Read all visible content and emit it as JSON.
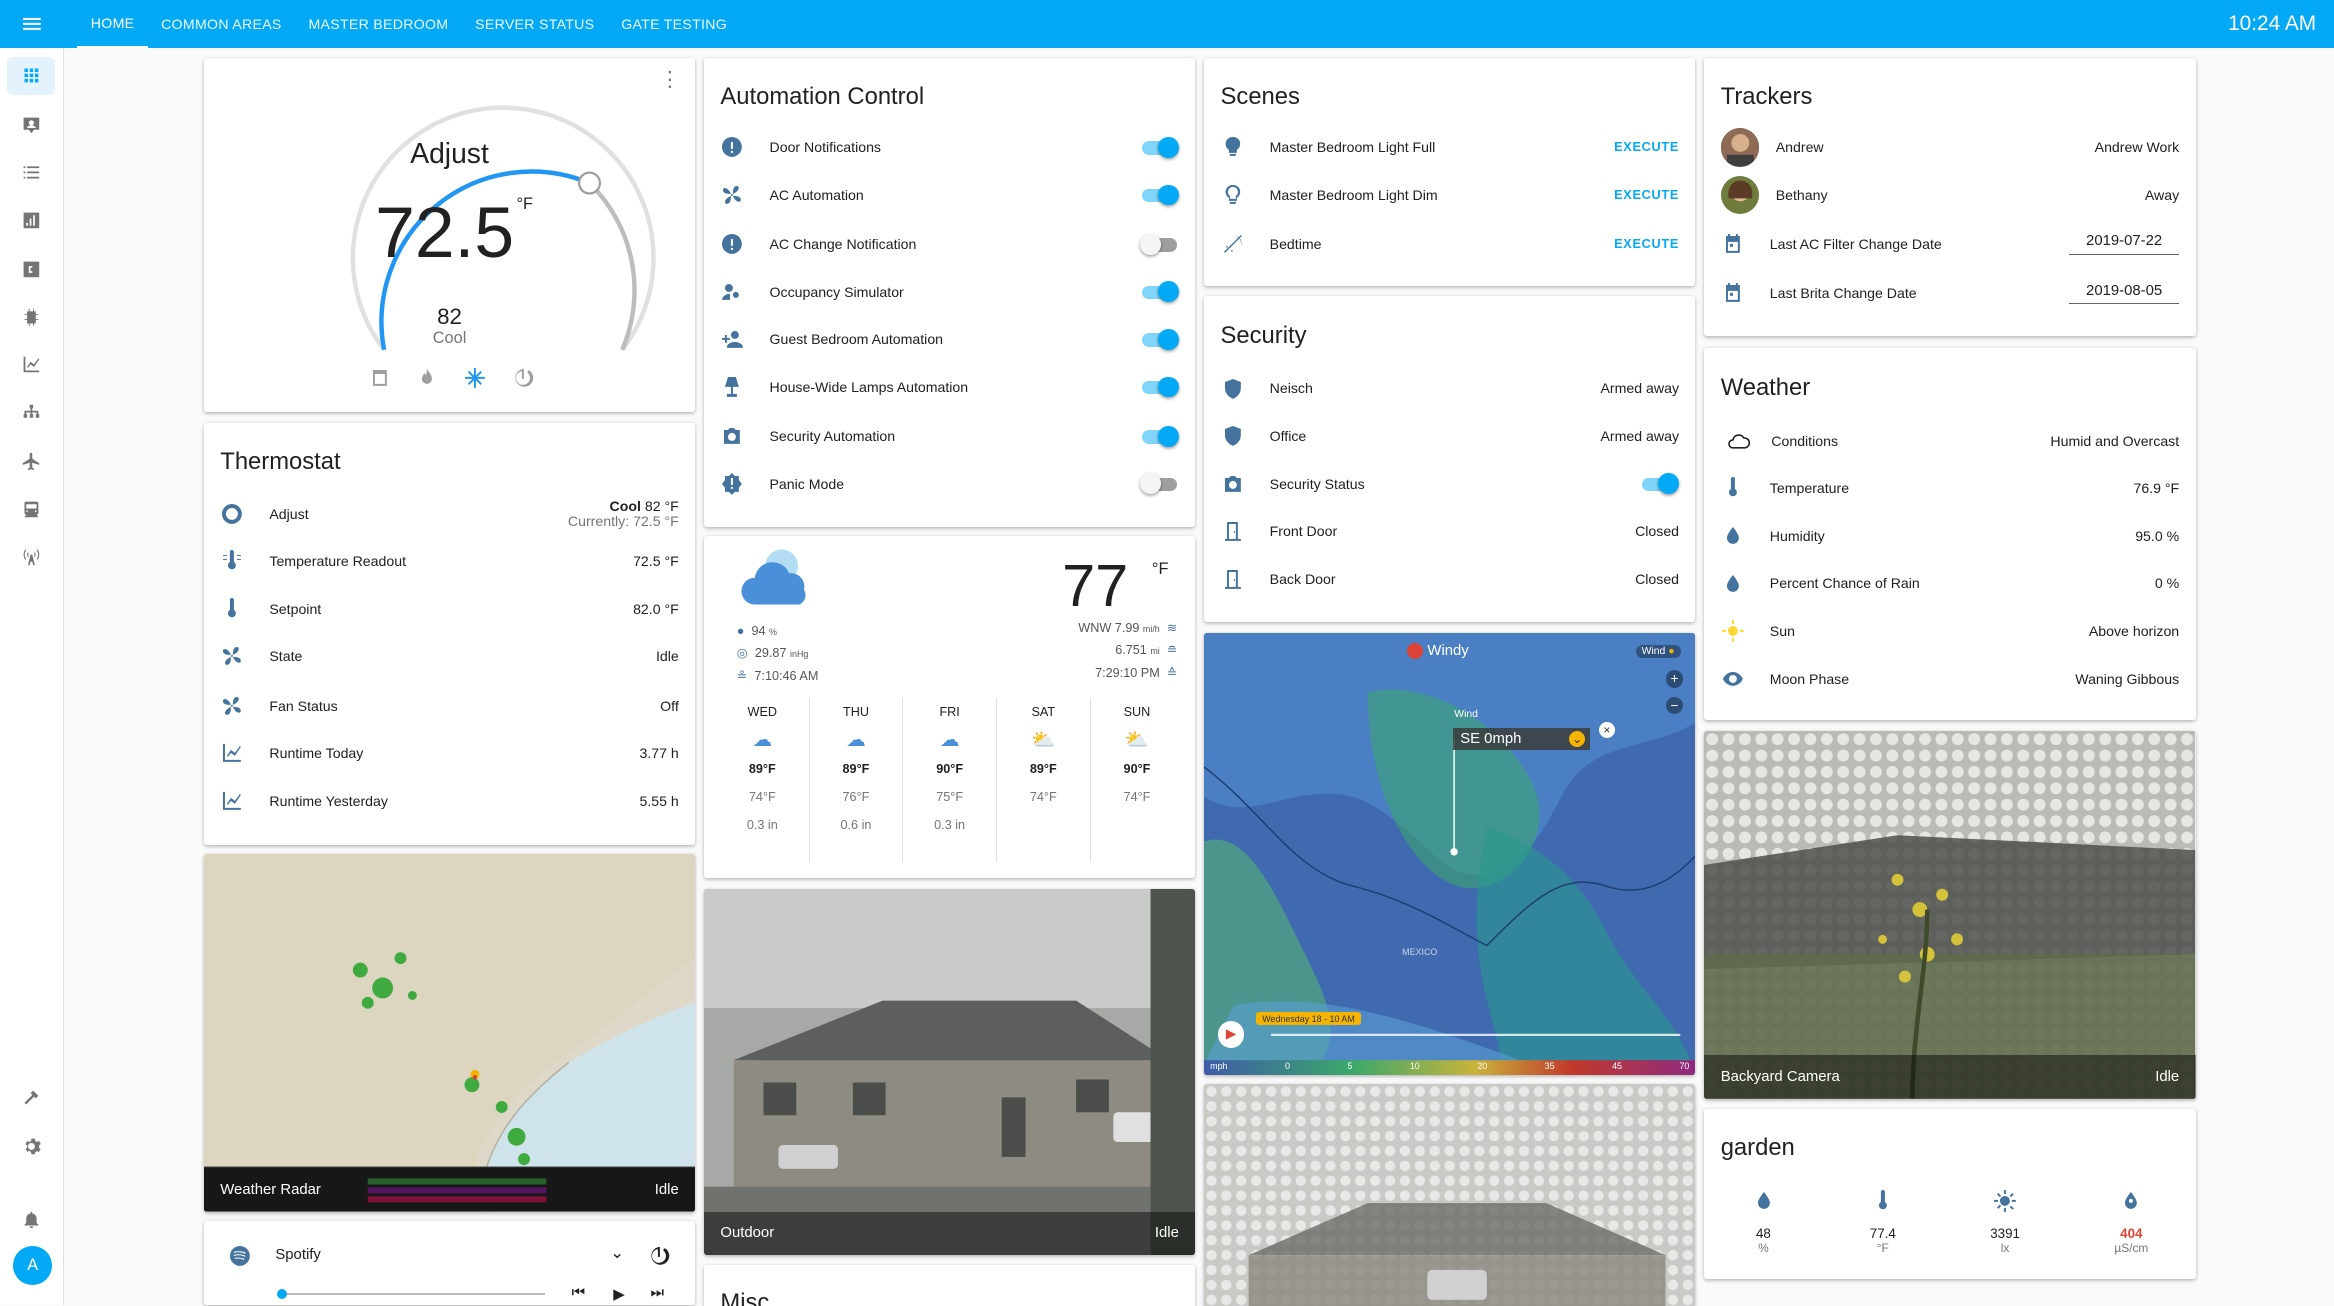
{
  "header": {
    "tabs": [
      "HOME",
      "COMMON AREAS",
      "MASTER BEDROOM",
      "SERVER STATUS",
      "GATE TESTING"
    ],
    "clock": "10:24 AM"
  },
  "sidebar": {
    "icons": [
      "dashboard-icon",
      "account-box-icon",
      "list-icon",
      "chart-bar-icon",
      "calendar-icon",
      "chip-icon",
      "chart-line-icon",
      "hierarchy-icon",
      "airplane-icon",
      "train-icon",
      "radio-tower-icon",
      "hammer-icon",
      "gear-icon",
      "bell-icon"
    ],
    "avatar": "A"
  },
  "thermostat_dial": {
    "label": "Adjust",
    "temp": "72.5",
    "unit": "°F",
    "target": "82",
    "mode": "Cool"
  },
  "thermostat": {
    "title": "Thermostat",
    "adjust_mode": "Cool",
    "adjust_target": "82 °F",
    "adjust_current": "Currently: 72.5 °F",
    "rows": [
      {
        "label": "Adjust"
      },
      {
        "label": "Temperature Readout",
        "value": "72.5 °F"
      },
      {
        "label": "Setpoint",
        "value": "82.0 °F"
      },
      {
        "label": "State",
        "value": "Idle"
      },
      {
        "label": "Fan Status",
        "value": "Off"
      },
      {
        "label": "Runtime Today",
        "value": "3.77 h"
      },
      {
        "label": "Runtime Yesterday",
        "value": "5.55 h"
      }
    ]
  },
  "radar": {
    "label": "Weather Radar",
    "state": "Idle"
  },
  "spotify": {
    "label": "Spotify"
  },
  "automation": {
    "title": "Automation Control",
    "rows": [
      {
        "label": "Door Notifications",
        "on": true
      },
      {
        "label": "AC Automation",
        "on": true
      },
      {
        "label": "AC Change Notification",
        "on": false
      },
      {
        "label": "Occupancy Simulator",
        "on": true
      },
      {
        "label": "Guest Bedroom Automation",
        "on": true
      },
      {
        "label": "House-Wide Lamps Automation",
        "on": true
      },
      {
        "label": "Security Automation",
        "on": true
      },
      {
        "label": "Panic Mode",
        "on": false
      }
    ]
  },
  "forecast": {
    "temp": "77",
    "unit": "°F",
    "humidity": "94",
    "humidity_unit": "%",
    "pressure": "29.87",
    "pressure_unit": "inHg",
    "sunrise": "7:10:46 AM",
    "wind": "WNW 7.99",
    "wind_unit": "mi/h",
    "visibility": "6.751",
    "visibility_unit": "mi",
    "sunset": "7:29:10 PM",
    "days": [
      {
        "day": "WED",
        "high": "89°F",
        "low": "74°F",
        "precip": "0.3 in"
      },
      {
        "day": "THU",
        "high": "89°F",
        "low": "76°F",
        "precip": "0.6 in"
      },
      {
        "day": "FRI",
        "high": "90°F",
        "low": "75°F",
        "precip": "0.3 in"
      },
      {
        "day": "SAT",
        "high": "89°F",
        "low": "74°F",
        "precip": ""
      },
      {
        "day": "SUN",
        "high": "90°F",
        "low": "74°F",
        "precip": ""
      }
    ]
  },
  "outdoor": {
    "label": "Outdoor",
    "state": "Idle"
  },
  "misc": {
    "title": "Misc"
  },
  "scenes": {
    "title": "Scenes",
    "execute": "EXECUTE",
    "rows": [
      {
        "label": "Master Bedroom Light Full"
      },
      {
        "label": "Master Bedroom Light Dim"
      },
      {
        "label": "Bedtime"
      }
    ]
  },
  "security": {
    "title": "Security",
    "rows": [
      {
        "label": "Neisch",
        "value": "Armed away"
      },
      {
        "label": "Office",
        "value": "Armed away"
      },
      {
        "label": "Security Status",
        "toggle": true
      },
      {
        "label": "Front Door",
        "value": "Closed"
      },
      {
        "label": "Back Door",
        "value": "Closed"
      }
    ]
  },
  "windy": {
    "brand": "Windy",
    "layer": "Wind",
    "wind_label": "Wind",
    "wind_value": "SE 0mph",
    "timeline": "Wednesday 18 - 10 AM",
    "scale_unit": "mph",
    "scale": [
      "0",
      "5",
      "10",
      "20",
      "35",
      "45",
      "70"
    ],
    "country": "MEXICO"
  },
  "trackers": {
    "title": "Trackers",
    "rows": [
      {
        "label": "Andrew",
        "value": "Andrew Work"
      },
      {
        "label": "Bethany",
        "value": "Away"
      },
      {
        "label": "Last AC Filter Change Date",
        "value": "2019-07-22"
      },
      {
        "label": "Last Brita Change Date",
        "value": "2019-08-05"
      }
    ]
  },
  "weather": {
    "title": "Weather",
    "rows": [
      {
        "label": "Conditions",
        "value": "Humid and Overcast"
      },
      {
        "label": "Temperature",
        "value": "76.9 °F"
      },
      {
        "label": "Humidity",
        "value": "95.0 %"
      },
      {
        "label": "Percent Chance of Rain",
        "value": "0 %"
      },
      {
        "label": "Sun",
        "value": "Above horizon"
      },
      {
        "label": "Moon Phase",
        "value": "Waning Gibbous"
      }
    ]
  },
  "backyard": {
    "label": "Backyard Camera",
    "state": "Idle"
  },
  "garden": {
    "title": "garden",
    "sensors": [
      {
        "value": "48",
        "unit": "%"
      },
      {
        "value": "77.4",
        "unit": "°F"
      },
      {
        "value": "3391",
        "unit": "lx"
      },
      {
        "value": "404",
        "unit": "µS/cm"
      }
    ]
  },
  "colors": {
    "header": "#03a9f4",
    "icon": "#44739e",
    "alert": "#db4437"
  }
}
